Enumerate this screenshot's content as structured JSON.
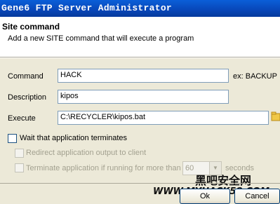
{
  "window": {
    "title": "Gene6 FTP Server Administrator"
  },
  "header": {
    "title": "Site command",
    "subtitle": "Add a new SITE command that will execute a program"
  },
  "form": {
    "command": {
      "label": "Command",
      "value": "HACK",
      "hint": "ex: BACKUP"
    },
    "description": {
      "label": "Description",
      "value": "kipos"
    },
    "execute": {
      "label": "Execute",
      "value": "C:\\RECYCLER\\kipos.bat"
    },
    "wait": {
      "label": "Wait that application terminates",
      "checked": false
    },
    "redirect": {
      "label": "Redirect application output to client",
      "checked": false,
      "enabled": false
    },
    "terminate": {
      "label": "Terminate application if running for more than",
      "value": "60",
      "unit": "seconds",
      "checked": false,
      "enabled": false
    }
  },
  "buttons": {
    "ok": "Ok",
    "cancel": "Cancel"
  },
  "watermark": {
    "cn": "黑吧安全网",
    "url": "WWW.MYHACK58.COM"
  },
  "colors": {
    "title_bar": "#0a5fd8",
    "dialog_bg": "#ece9d8",
    "disabled_text": "#a3a190"
  }
}
